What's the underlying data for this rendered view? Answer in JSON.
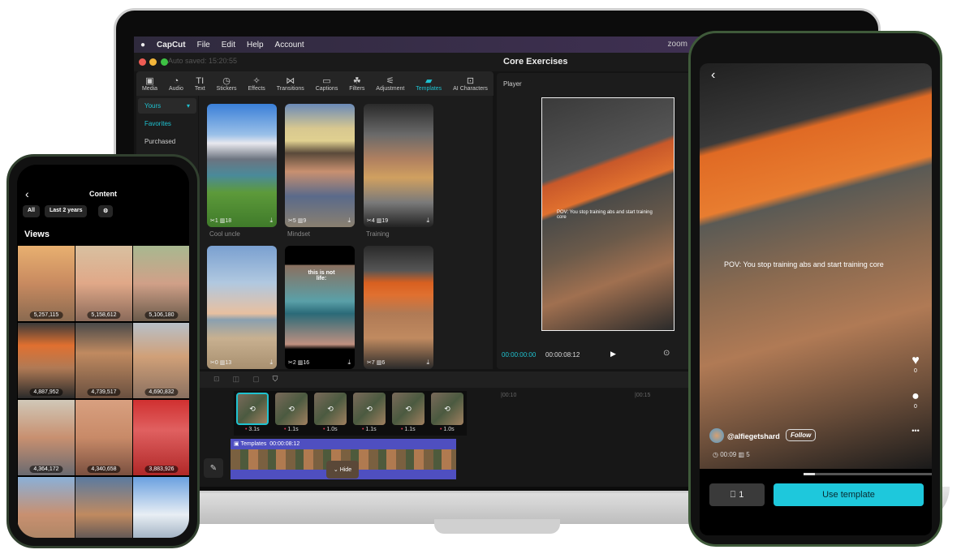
{
  "laptop": {
    "menubar": {
      "apple": "",
      "app": "CapCut",
      "items": [
        "File",
        "Edit",
        "Help",
        "Account"
      ],
      "zoom": "zoom"
    },
    "autosave": "Auto saved: 15:20:55",
    "project_title": "Core Exercises",
    "toolbar": [
      {
        "label": "Media",
        "icon": "▣"
      },
      {
        "label": "Audio",
        "icon": "◔"
      },
      {
        "label": "Text",
        "icon": "TI"
      },
      {
        "label": "Stickers",
        "icon": "◷"
      },
      {
        "label": "Effects",
        "icon": "✧"
      },
      {
        "label": "Transitions",
        "icon": "⋈"
      },
      {
        "label": "Captions",
        "icon": "▭"
      },
      {
        "label": "Filters",
        "icon": "☘"
      },
      {
        "label": "Adjustment",
        "icon": "⚟"
      },
      {
        "label": "Templates",
        "icon": "▰",
        "active": true
      },
      {
        "label": "AI Characters",
        "icon": "⊡"
      }
    ],
    "side_menu": [
      {
        "label": "Yours",
        "chevron": "▾"
      },
      {
        "label": "Favorites"
      },
      {
        "label": "Purchased"
      }
    ],
    "templates": [
      {
        "title": "Cool uncle",
        "clips": "1",
        "duration": "18",
        "bg": "linear-gradient(180deg,#3a7fd8 0%,#9ac0e8 25%,#e8e8ee 32%,#6c7480 45%,#4a8a9a 58%,#5d9a3a 72%,#3f7a2a 100%)"
      },
      {
        "title": "Mindset",
        "clips": "5",
        "duration": "9",
        "bg": "linear-gradient(180deg,#6a8ab8 0%,#d8c890 20%,#e0d090 30%,#5a4a3a 40%,#c89070 55%,#5a6a8a 75%,#8a8070 100%)"
      },
      {
        "title": "Training",
        "clips": "4",
        "duration": "19",
        "bg": "linear-gradient(180deg,#2a2a2a 0%,#6a6a6a 25%,#b08060 45%,#d0a060 60%,#7a7a7a 80%,#222 100%)"
      },
      {
        "title": "",
        "clips": "0",
        "duration": "13",
        "bg": "linear-gradient(180deg,#7aa0d0 0%,#b0c8e0 30%,#e8c0a0 55%,#8aa0b0 60%,#c8b090 75%,#a89070 100%)"
      },
      {
        "title": "",
        "clips": "2",
        "duration": "16",
        "bg": "linear-gradient(180deg,#000 0%,#000 15%,#8a7060 16%,#5aa0a8 45%,#2a6a78 55%,#c09080 80%,#000 84%,#000 100%)",
        "overlay": "this is not life:"
      },
      {
        "title": "",
        "clips": "7",
        "duration": "6",
        "bg": "linear-gradient(180deg,#2a2a2a 0%,#555 20%,#d86020 30%,#e07030 40%,#b07a55 55%,#c08a60 75%,#2a2a2a 100%)"
      }
    ],
    "player": {
      "label": "Player",
      "caption": "POV: You stop training abs and start training core",
      "current_time": "00:00:00:00",
      "total_time": "00:00:08:12",
      "play_icon": "▶",
      "fit_icon": "⊙"
    },
    "timeline": {
      "ruler": [
        "|00:10",
        "|00:15"
      ],
      "clip_durations": [
        "3.1s",
        "1.1s",
        "1.0s",
        "1.1s",
        "1.1s",
        "1.0s"
      ],
      "track_label": "Templates",
      "track_time": "00:00:08:12",
      "hide_label": "⌄  Hide",
      "edit_icon": "✎"
    }
  },
  "left_phone": {
    "back": "‹",
    "title": "Content",
    "filters": [
      "All",
      "Last 2 years",
      "⚙"
    ],
    "section": "Views",
    "videos": [
      {
        "views": "5,257,115",
        "bg": "linear-gradient(180deg,#e8b070,#c88a60 50%,#8a6a50)"
      },
      {
        "views": "5,158,612",
        "bg": "linear-gradient(180deg,#d8c0a0,#e0a888 50%,#8a6a5a)"
      },
      {
        "views": "5,106,180",
        "bg": "linear-gradient(180deg,#a8b890,#d0a088 50%,#6a5a4a)"
      },
      {
        "views": "4,887,952",
        "bg": "linear-gradient(180deg,#3a3a3a,#e07030 30%,#b07a55 60%,#2a2a2a)"
      },
      {
        "views": "4,739,517",
        "bg": "linear-gradient(180deg,#4a4a4a,#c08a60 40%,#6a5040)"
      },
      {
        "views": "4,690,832",
        "bg": "linear-gradient(180deg,#b8c0c8,#d0a078 45%,#8a7060)"
      },
      {
        "views": "4,364,172",
        "bg": "linear-gradient(180deg,#d0c8b8,#c89070 50%,#6a6a70)"
      },
      {
        "views": "4,340,658",
        "bg": "linear-gradient(180deg,#d8a080,#c88a68 50%,#7a5040)"
      },
      {
        "views": "3,883,926",
        "bg": "linear-gradient(180deg,#d03030,#e06060 40%,#b02828)"
      },
      {
        "views": "",
        "bg": "linear-gradient(180deg,#8ab0d8,#c89070 50%,#a08060)"
      },
      {
        "views": "",
        "bg": "linear-gradient(180deg,#5a7aa0,#c08a60 50%,#2a3a50)"
      },
      {
        "views": "",
        "bg": "linear-gradient(180deg,#6aa0e0,#e8eef4 50%,#7a90a8)"
      }
    ]
  },
  "right_phone": {
    "back": "‹",
    "caption": "POV: You stop training abs and start training core",
    "likes": "0",
    "comments": "0",
    "more": "•••",
    "username": "@alfiegetshard",
    "follow": "Follow",
    "duration": "◷ 00:09  ▥ 5",
    "playback_progress": 0.09,
    "save_icon": "⎕",
    "saves": "1",
    "use_template": "Use template",
    "accent": "#1ec8dc"
  }
}
